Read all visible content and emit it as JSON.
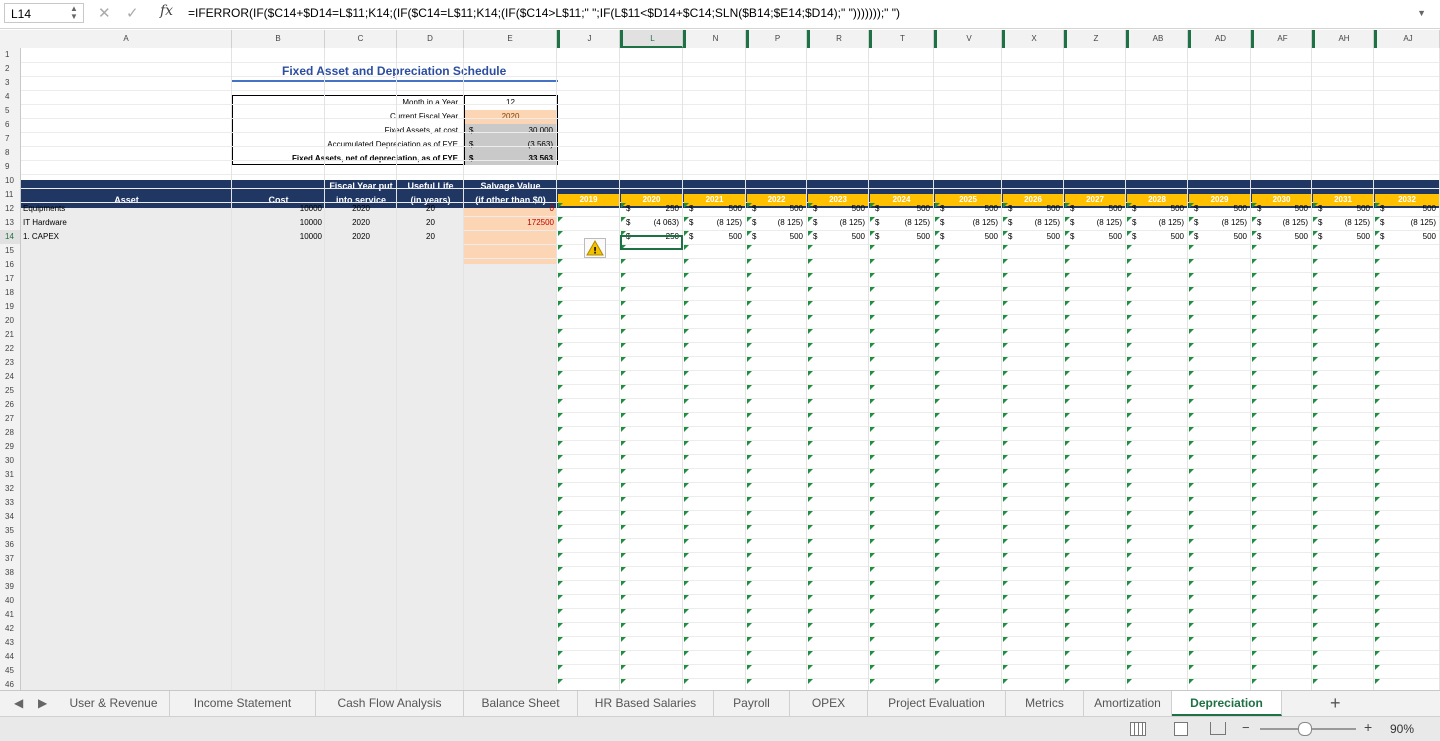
{
  "formula_bar": {
    "name_box": "L14",
    "cancel_glyph": "✕",
    "enter_glyph": "✓",
    "fx_label": "fx",
    "formula": "=IFERROR(IF($C14+$D14=L$11;K14;(IF($C14=L$11;K14;(IF($C14>L$11;\" \";IF(L$11<$D14+$C14;SLN($B14;$E14;$D14);\" \")))))));\" \")"
  },
  "columns": [
    "A",
    "B",
    "C",
    "D",
    "E",
    "J",
    "L",
    "N",
    "P",
    "R",
    "T",
    "V",
    "X",
    "Z",
    "AB",
    "AD",
    "AF",
    "AH",
    "AJ"
  ],
  "selected_column": "L",
  "rows": [
    "1",
    "2",
    "3",
    "4",
    "5",
    "6",
    "7",
    "8",
    "9",
    "10",
    "11",
    "12",
    "13",
    "14",
    "15",
    "16",
    "17",
    "18",
    "19",
    "20",
    "21",
    "22",
    "23",
    "24",
    "25",
    "26",
    "27",
    "28",
    "29",
    "30",
    "31",
    "32",
    "33",
    "34",
    "35",
    "36",
    "37",
    "38",
    "39",
    "40",
    "41",
    "42",
    "43",
    "44",
    "45",
    "46"
  ],
  "selected_row": "14",
  "sheet_title": "Fixed Asset and Depreciation Schedule",
  "summary": {
    "month_label": "Month in a Year",
    "month_value": "12",
    "fy_label": "Current Fiscal Year",
    "fy_value": "2020",
    "fa_cost_label": "Fixed Assets, at cost",
    "fa_cost_value": "30 000",
    "acc_dep_label": "Accumulated Depreciation as of FYE",
    "acc_dep_value": "(3 563)",
    "fa_net_label": "Fixed Assets, net of depreciation, as of FYE",
    "fa_net_value": "33 563",
    "currency": "$"
  },
  "table_headers": {
    "asset": "Asset",
    "cost": "Cost",
    "fiscal_year_1": "Fiscal Year put",
    "fiscal_year_2": "into service",
    "useful_life_1": "Useful Life",
    "useful_life_2": "(in years)",
    "salvage_1": "Salvage Value",
    "salvage_2": "(if other than $0)"
  },
  "years": [
    "2019",
    "2020",
    "2021",
    "2022",
    "2023",
    "2024",
    "2025",
    "2026",
    "2027",
    "2028",
    "2029",
    "2030",
    "2031",
    "2032"
  ],
  "assets": [
    {
      "name": "Equipments",
      "cost": "10000",
      "fy": "2020",
      "life": "20",
      "salvage": "0",
      "values": [
        "",
        "250",
        "500",
        "500",
        "500",
        "500",
        "500",
        "500",
        "500",
        "500",
        "500",
        "500",
        "500",
        "500"
      ]
    },
    {
      "name": "IT Hardware",
      "cost": "10000",
      "fy": "2020",
      "life": "20",
      "salvage": "172500",
      "values": [
        "",
        "(4 063)",
        "(8 125)",
        "(8 125)",
        "(8 125)",
        "(8 125)",
        "(8 125)",
        "(8 125)",
        "(8 125)",
        "(8 125)",
        "(8 125)",
        "(8 125)",
        "(8 125)",
        "(8 125)"
      ]
    },
    {
      "name": "1. CAPEX",
      "cost": "10000",
      "fy": "2020",
      "life": "20",
      "salvage": "",
      "values": [
        "",
        "250",
        "500",
        "500",
        "500",
        "500",
        "500",
        "500",
        "500",
        "500",
        "500",
        "500",
        "500",
        "500"
      ]
    }
  ],
  "warning_glyph": "⚠",
  "sheet_tabs": [
    "User & Revenue",
    "Income Statement",
    "Cash Flow Analysis",
    "Balance Sheet",
    "HR Based Salaries",
    "Payroll",
    "OPEX",
    "Project Evaluation",
    "Metrics",
    "Amortization",
    "Depreciation"
  ],
  "active_tab": "Depreciation",
  "add_sheet_glyph": "+",
  "zoom": "90%",
  "zoom_minus": "−",
  "zoom_plus": "+",
  "colors": {
    "header_navy": "#203764",
    "year_gold": "#ffc000",
    "salvage_peach": "#fcd5b4",
    "accent_green": "#1e7145",
    "title_blue": "#2b4ea0"
  }
}
